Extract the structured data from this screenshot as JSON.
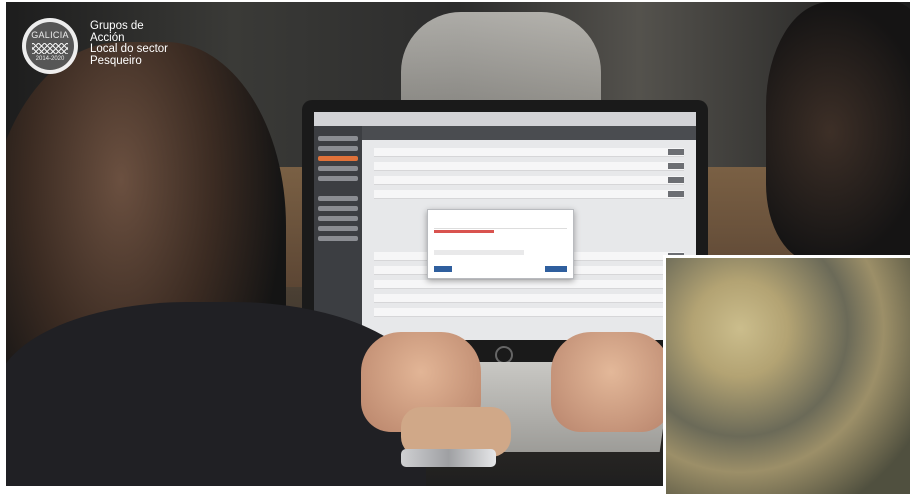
{
  "logo": {
    "top_text": "GALICIA",
    "years": "2014-2020",
    "caption_lines": [
      "Grupos de",
      "Acción",
      "Local do sector",
      "Pesqueiro"
    ]
  },
  "colors": {
    "accent_orange": "#e0723a",
    "progress_red": "#d9534f",
    "button_blue": "#2f5f9e"
  },
  "scene": {
    "laptop_brand_icon": "hp-logo-icon"
  }
}
